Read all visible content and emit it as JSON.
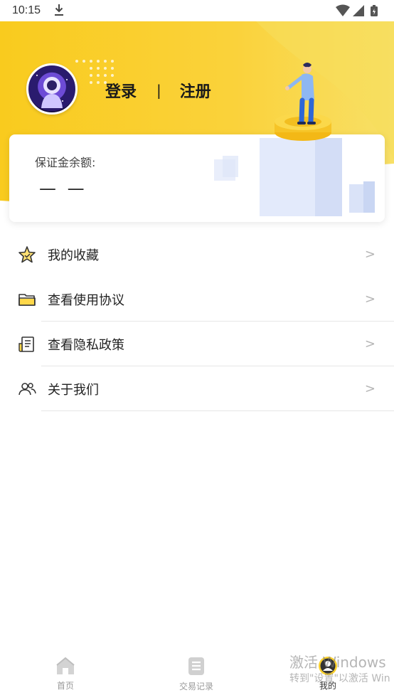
{
  "status_bar": {
    "time": "10:15",
    "icons": [
      "download-icon",
      "wifi-icon",
      "signal-icon",
      "battery-icon"
    ]
  },
  "header": {
    "login": "登录",
    "separator": "|",
    "register": "注册",
    "colors": {
      "primary": "#FAD02C",
      "secondary": "#F6E36A"
    }
  },
  "balance_card": {
    "label": "保证金余额:",
    "value": "— —"
  },
  "menu": {
    "items": [
      {
        "label": "我的收藏",
        "icon": "star-icon",
        "arrow": ">"
      },
      {
        "label": "查看使用协议",
        "icon": "folder-icon",
        "arrow": ">"
      },
      {
        "label": "查看隐私政策",
        "icon": "document-icon",
        "arrow": ">"
      },
      {
        "label": "关于我们",
        "icon": "users-icon",
        "arrow": ">"
      }
    ]
  },
  "tabbar": {
    "tabs": [
      {
        "label": "首页",
        "icon": "home-icon",
        "active": false
      },
      {
        "label": "交易记录",
        "icon": "records-icon",
        "active": false
      },
      {
        "label": "我的",
        "icon": "profile-icon",
        "active": true
      }
    ]
  },
  "watermark": {
    "line1": "激活 Windows",
    "line2": "转到\"设置\"以激活 Win"
  }
}
